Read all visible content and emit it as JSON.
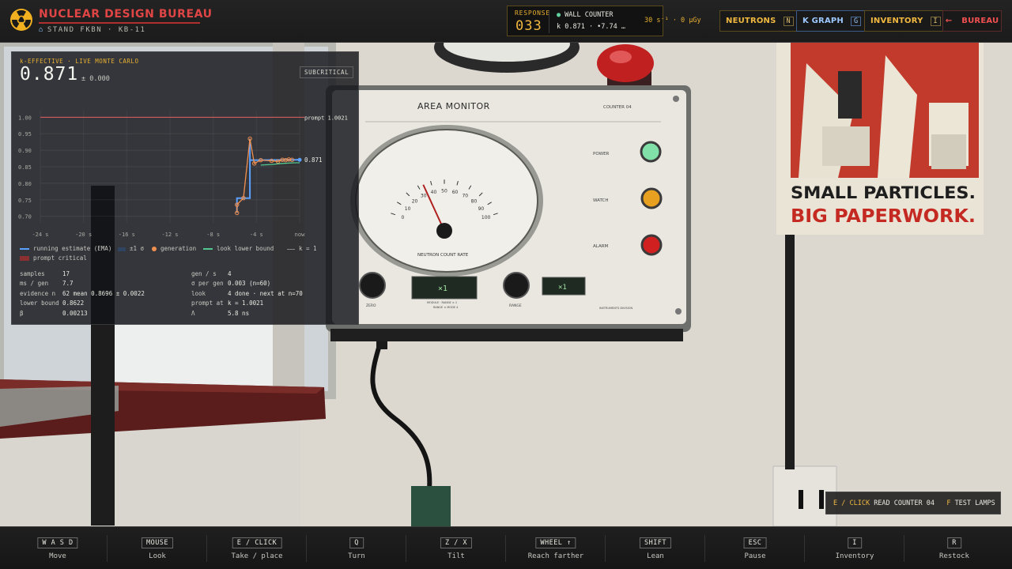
{
  "brand": {
    "title": "NUCLEAR DESIGN BUREAU",
    "subtitle": "STAND FKBN · KB-11",
    "logo_icon": "radiation-trefoil-icon",
    "accent": "#e04545"
  },
  "response": {
    "label": "RESPONSE",
    "value": "033",
    "counter_label": "WALL COUNTER",
    "counter_k": "k 0.871 · •7.74 …",
    "rate": "30 s⁻¹ · 0 µGy"
  },
  "nav": {
    "neutrons": {
      "label": "NEUTRONS",
      "key": "N"
    },
    "kgraph": {
      "label": "K GRAPH",
      "key": "G"
    },
    "inventory": {
      "label": "INVENTORY",
      "key": "I"
    },
    "bureau": {
      "label": "BUREAU",
      "arrow": "←"
    }
  },
  "kpanel": {
    "header": "k-EFFECTIVE · LIVE MONTE CARLO",
    "value": "0.871",
    "uncertainty": "± 0.000",
    "status": "SUBCRITICAL",
    "legend": {
      "running": "running estimate (EMA)",
      "sigma": "±1 σ",
      "generation": "generation",
      "lower": "look lower bound",
      "k1": "k = 1",
      "prompt": "prompt critical"
    },
    "stats": {
      "samples_label": "samples",
      "samples": "17",
      "ms_label": "ms / gen",
      "ms": "7.7",
      "evidence_label": "evidence n",
      "evidence": "62 mean 0.8696 ± 0.0022",
      "lower_label": "lower bound",
      "lower": "0.8622",
      "beta_label": "β",
      "beta": "0.00213",
      "gens_label": "gen / s",
      "gens": "4",
      "sigma_label": "σ per gen",
      "sigma": "0.003 (n=60)",
      "look_label": "look",
      "look": "4 done · next at n=70",
      "prompt_label": "prompt at",
      "prompt": "k = 1.0021",
      "lambda_label": "Λ",
      "lambda": "5.8 ns"
    }
  },
  "chart_data": {
    "type": "line",
    "title": "",
    "xlabel": "",
    "ylabel": "",
    "xlim": [
      -24,
      0
    ],
    "ylim": [
      0.68,
      1.02
    ],
    "x_ticks": [
      "-24 s",
      "-20 s",
      "-16 s",
      "-12 s",
      "-8 s",
      "-4 s",
      "now"
    ],
    "y_ticks": [
      "1.00",
      "0.95",
      "0.90",
      "0.85",
      "0.80",
      "0.75",
      "0.70"
    ],
    "prompt_line": {
      "value": 1.0021,
      "label": "prompt 1.0021",
      "color": "#e06060"
    },
    "end_label": "0.871",
    "series": [
      {
        "name": "running estimate (EMA)",
        "color": "#5aa0ff",
        "points": [
          [
            -5.8,
            0.71
          ],
          [
            -5.8,
            0.755
          ],
          [
            -4.6,
            0.755
          ],
          [
            -4.6,
            0.935
          ],
          [
            -4.6,
            0.87
          ],
          [
            -3.6,
            0.87
          ],
          [
            -1.0,
            0.871
          ],
          [
            0,
            0.871
          ]
        ]
      },
      {
        "name": "generation",
        "color": "#f09050",
        "points": [
          [
            -5.8,
            0.71
          ],
          [
            -5.8,
            0.735
          ],
          [
            -5.2,
            0.755
          ],
          [
            -4.6,
            0.935
          ],
          [
            -4.2,
            0.86
          ],
          [
            -3.6,
            0.87
          ],
          [
            -2.6,
            0.868
          ],
          [
            -2.0,
            0.866
          ],
          [
            -1.6,
            0.871
          ],
          [
            -1.3,
            0.87
          ],
          [
            -1.0,
            0.872
          ],
          [
            -0.7,
            0.871
          ]
        ]
      },
      {
        "name": "look lower bound",
        "color": "#50c890",
        "points": [
          [
            -3.6,
            0.855
          ],
          [
            -2.6,
            0.857
          ],
          [
            -1.6,
            0.86
          ],
          [
            -0.5,
            0.862
          ],
          [
            0,
            0.862
          ]
        ]
      }
    ],
    "grid": true
  },
  "prompt": {
    "key1": "E / CLICK",
    "action1": "READ COUNTER 04",
    "key2": "F",
    "action2": "TEST LAMPS"
  },
  "monitor": {
    "title": "AREA MONITOR",
    "counter": "COUNTER 04",
    "dial_label": "NEUTRON COUNT RATE",
    "dial_reading": 34,
    "scale": [
      "0",
      "10",
      "20",
      "30",
      "40",
      "50",
      "60",
      "70",
      "80",
      "90",
      "100"
    ],
    "power": "POWER",
    "watch": "WATCH",
    "alarm": "ALARM",
    "zero": "ZERO",
    "range": "RANGE",
    "mult1": "×1",
    "mult2": "×1",
    "mult_caption": "MODULE · RANGE × 1",
    "mult_caption2": "RANGE × MODE 4",
    "maker": "INSTRUMENTS DIVISION"
  },
  "poster": {
    "line1": "SMALL PARTICLES.",
    "line2": "BIG PAPERWORK."
  },
  "controls": [
    {
      "key": "W A S D",
      "action": "Move"
    },
    {
      "key": "MOUSE",
      "action": "Look"
    },
    {
      "key": "E / CLICK",
      "action": "Take / place"
    },
    {
      "key": "Q",
      "action": "Turn"
    },
    {
      "key": "Z / X",
      "action": "Tilt"
    },
    {
      "key": "WHEEL ↑",
      "action": "Reach farther"
    },
    {
      "key": "SHIFT",
      "action": "Lean"
    },
    {
      "key": "ESC",
      "action": "Pause"
    },
    {
      "key": "I",
      "action": "Inventory"
    },
    {
      "key": "R",
      "action": "Restock"
    }
  ]
}
